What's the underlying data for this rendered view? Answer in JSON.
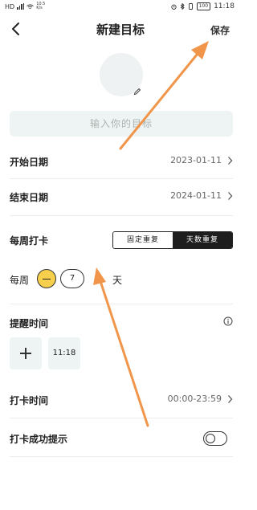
{
  "status_bar": {
    "network": "HD",
    "net_speed": "10.5 K/s",
    "battery": "100",
    "time": "11:18"
  },
  "header": {
    "title": "新建目标",
    "save_label": "保存"
  },
  "goal_name": {
    "placeholder": "输入你的目标",
    "value": ""
  },
  "form": {
    "start_date": {
      "label": "开始日期",
      "value": "2023-01-11"
    },
    "end_date": {
      "label": "结束日期",
      "value": "2024-01-11"
    },
    "weekly_checkin": {
      "label": "每周打卡",
      "options": [
        "固定重复",
        "天数重复"
      ],
      "selected": "天数重复"
    },
    "days_per_week": {
      "prefix": "每周",
      "value": "7",
      "suffix": "天"
    },
    "reminder": {
      "label": "提醒时间",
      "times": [
        "11:18"
      ]
    },
    "checkin_time": {
      "label": "打卡时间",
      "value": "00:00-23:59"
    },
    "success_tip": {
      "label": "打卡成功提示",
      "enabled": false
    }
  },
  "colors": {
    "accent": "#f6d04d",
    "annotation_arrow": "#f0954a",
    "input_bg": "#eef4f3"
  },
  "icons": [
    "back-arrow-icon",
    "pencil-icon",
    "info-icon",
    "plus-icon",
    "minus-icon",
    "chevron-right-icon"
  ]
}
